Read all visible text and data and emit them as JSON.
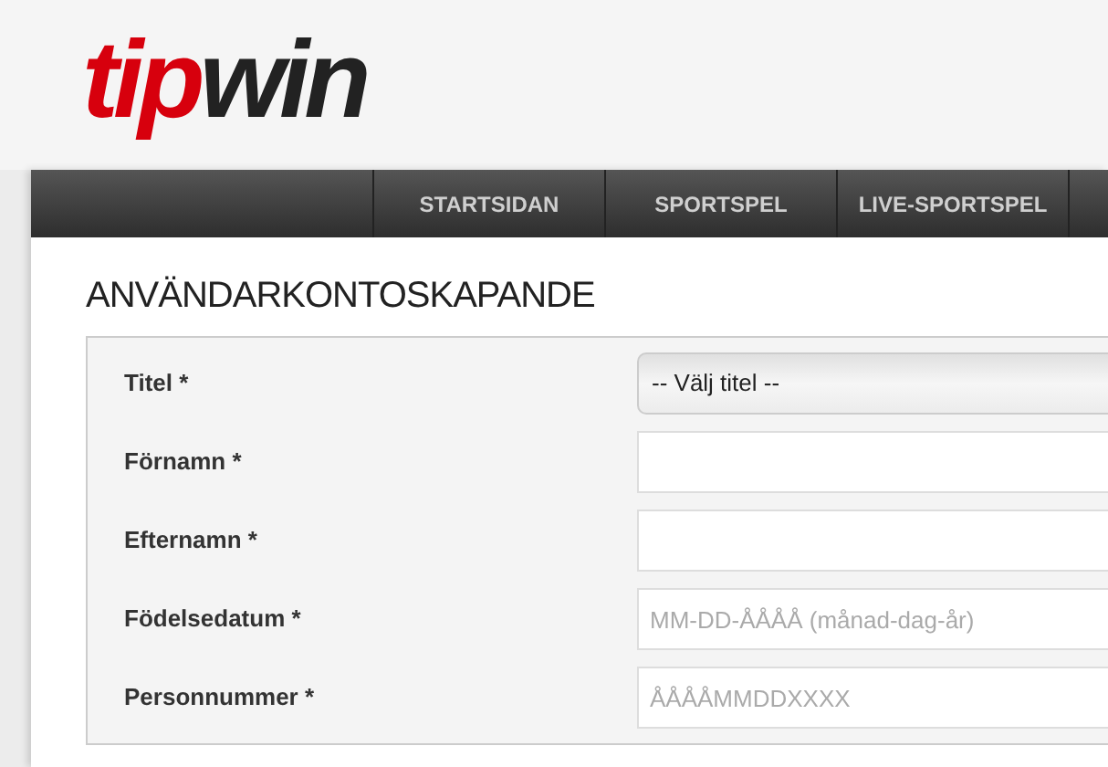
{
  "logo": {
    "part_1": "tip",
    "part_2": "win"
  },
  "nav": {
    "items": [
      {
        "label": "STARTSIDAN"
      },
      {
        "label": "SPORTSPEL"
      },
      {
        "label": "LIVE-SPORTSPEL"
      }
    ]
  },
  "page_title": "ANVÄNDARKONTOSKAPANDE",
  "form": {
    "fields": [
      {
        "label": "Titel *",
        "kind": "select",
        "value": "-- Välj titel --"
      },
      {
        "label": "Förnamn *",
        "kind": "text"
      },
      {
        "label": "Efternamn *",
        "kind": "text"
      },
      {
        "label": "Födelsedatum *",
        "kind": "text",
        "placeholder": "MM-DD-ÅÅÅÅ (månad-dag-år)"
      },
      {
        "label": "Personnummer *",
        "kind": "text",
        "placeholder": "ÅÅÅÅMMDDXXXX"
      }
    ]
  }
}
